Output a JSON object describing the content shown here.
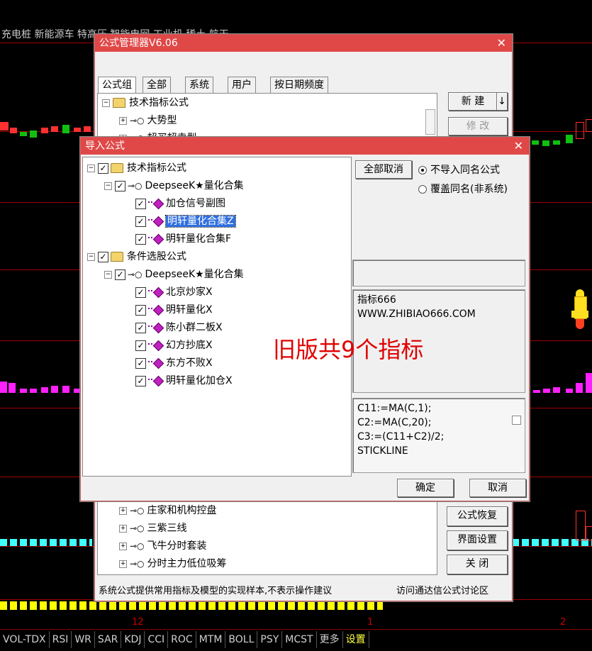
{
  "ticker": "充电桩 新能源车 特高压 智能电网 工业机 稀土 航天",
  "bottom_tabs": [
    "VOL-TDX",
    "RSI",
    "WR",
    "SAR",
    "KDJ",
    "CCI",
    "ROC",
    "MTM",
    "BOLL",
    "PSY",
    "MCST",
    "更多",
    "设置"
  ],
  "axis": {
    "n12": "12",
    "n1": "1",
    "n2": "2"
  },
  "manager": {
    "title": "公式管理器V6.06",
    "close": "✕",
    "tabs": [
      "公式组",
      "全部",
      "系统",
      "用户",
      "按日期频度"
    ],
    "tree_top": {
      "root": "技术指标公式",
      "item1": "大势型",
      "item2": "超买超卖型"
    },
    "tree_bottom": [
      "庄家和机构控盘",
      "三紫三线",
      "飞牛分时套装",
      "分时主力低位吸筹"
    ],
    "buttons": {
      "new": "新 建",
      "arrow": "↓",
      "modify": "修 改",
      "restore": "公式恢复",
      "ui": "界面设置",
      "close": "关 闭"
    },
    "status_left": "系统公式提供常用指标及模型的实现样本,不表示操作建议",
    "status_right": "访问通达信公式讨论区"
  },
  "import": {
    "title": "导入公式",
    "close": "✕",
    "tree": {
      "g1": "技术指标公式",
      "g1sub": "DeepseeK★量化合集",
      "g1items": [
        "加仓信号副图",
        "明轩量化合集Z",
        "明轩量化合集F"
      ],
      "g2": "条件选股公式",
      "g2sub": "DeepseeK★量化合集",
      "g2items": [
        "北京炒家X",
        "明轩量化X",
        "陈小群二板X",
        "幻方抄底X",
        "东方不败X",
        "明轩量化加仓X"
      ]
    },
    "cancel_all": "全部取消",
    "radio1": "不导入同名公式",
    "radio2": "覆盖同名(非系统)",
    "info_line1": "指标666",
    "info_line2": "WWW.ZHIBIAO666.COM",
    "code": [
      "C11:=MA(C,1);",
      "C2:=MA(C,20);",
      "C3:=(C11+C2)/2;",
      "STICKLINE"
    ],
    "ok": "确定",
    "cancel": "取消"
  },
  "overlay": "旧版共9个指标",
  "colors": {
    "title": "#e04848",
    "overlay": "#e00000",
    "select": "#3070e0"
  }
}
